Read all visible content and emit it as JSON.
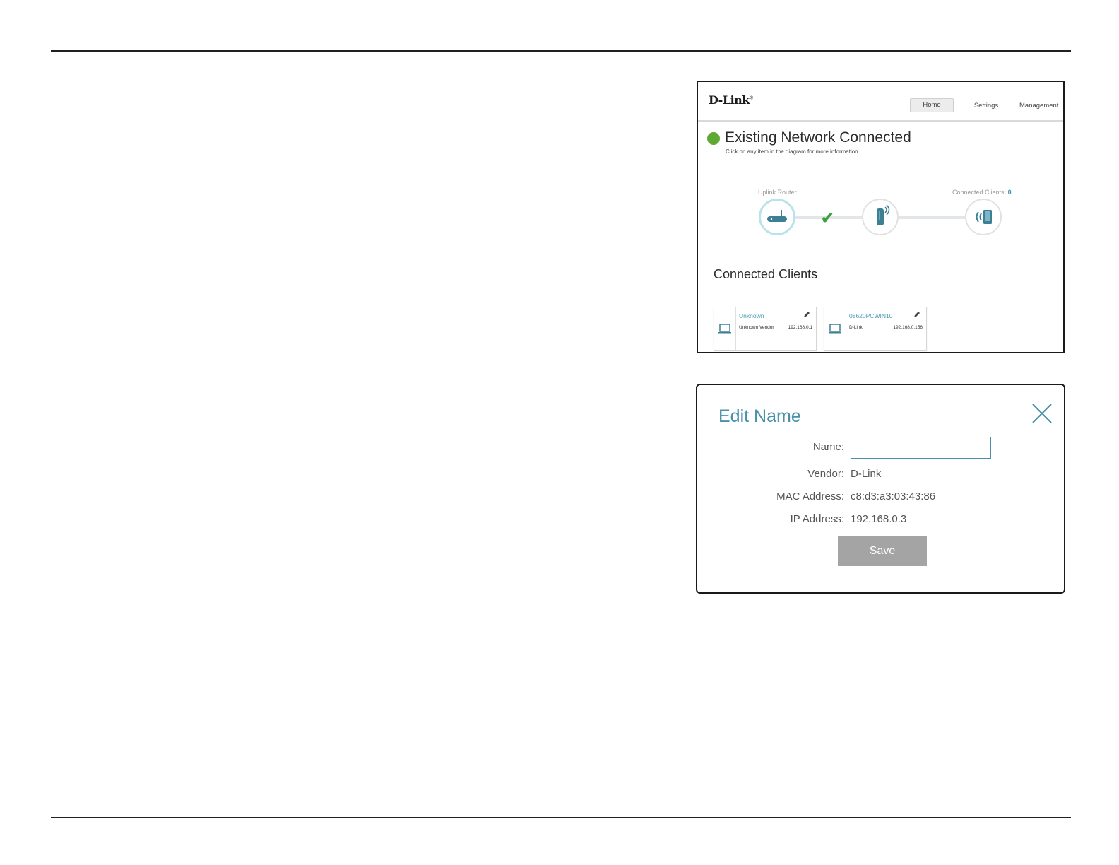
{
  "header": {
    "logo": "D-Link",
    "nav": {
      "home": "Home",
      "settings": "Settings",
      "management": "Management"
    }
  },
  "status": {
    "title": "Existing Network Connected",
    "subtitle": "Click on any item in the diagram for more information.",
    "color": "#5fa831"
  },
  "diagram": {
    "uplink_label": "Uplink Router",
    "clients_label": "Connected Clients:",
    "clients_count": "0"
  },
  "connected_clients": {
    "title": "Connected Clients",
    "cards": [
      {
        "name": "Unknown",
        "vendor": "Unknown Vendor",
        "ip": "192.168.0.1"
      },
      {
        "name": "08620PCWIN10",
        "vendor": "D-Link",
        "ip": "192.168.0.156"
      }
    ]
  },
  "edit_dialog": {
    "title": "Edit Name",
    "name_label": "Name:",
    "name_value": "",
    "vendor_label": "Vendor:",
    "vendor_value": "D-Link",
    "mac_label": "MAC Address:",
    "mac_value": "c8:d3:a3:03:43:86",
    "ip_label": "IP Address:",
    "ip_value": "192.168.0.3",
    "save_label": "Save",
    "accent": "#4a91a8"
  }
}
